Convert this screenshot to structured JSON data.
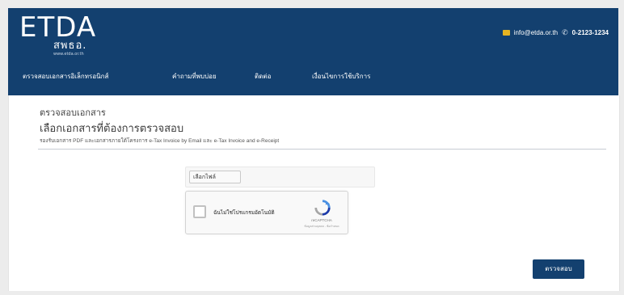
{
  "header": {
    "logo_text": "ETDA",
    "logo_subtext": "สพธอ.",
    "logo_url": "www.etda.or.th",
    "email": "info@etda.or.th",
    "phone": "0-2123-1234",
    "colors": {
      "header_bg": "#13406f",
      "mail_icon": "#e6b422"
    }
  },
  "nav": {
    "items": [
      {
        "label": "ตรวจสอบเอกสารอิเล็กทรอนิกส์"
      },
      {
        "label": "คำถามที่พบบ่อย"
      },
      {
        "label": "ติดต่อ"
      },
      {
        "label": "เงื่อนไขการใช้บริการ"
      }
    ]
  },
  "page": {
    "title": "ตรวจสอบเอกสาร",
    "subtitle": "เลือกเอกสารที่ต้องการตรวจสอบ",
    "description": "รองรับเอกสาร PDF และเอกสารภายใต้โครงการ e-Tax Invoice by Email และ e-Tax Invoice and e-Receipt"
  },
  "form": {
    "file_button_label": "เลือกไฟล์",
    "captcha": {
      "label": "ฉันไม่ใช่โปรแกรมอัตโนมัติ",
      "brand": "reCAPTCHA",
      "links": "ข้อมูลส่วนบุคคล - ข้อกำหนด"
    },
    "submit_label": "ตรวจสอบ"
  }
}
